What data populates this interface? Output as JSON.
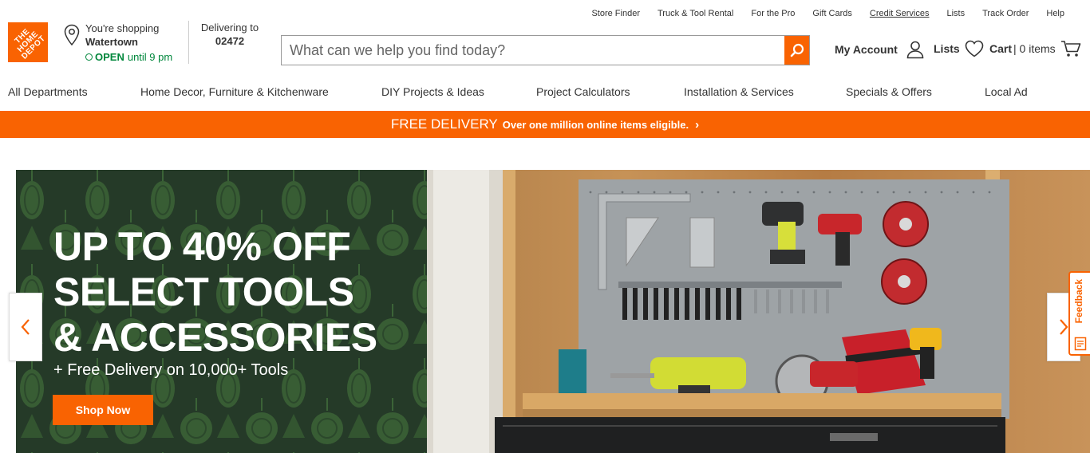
{
  "utility_links": [
    {
      "label": "Store Finder"
    },
    {
      "label": "Truck & Tool Rental"
    },
    {
      "label": "For the Pro"
    },
    {
      "label": "Gift Cards"
    },
    {
      "label": "Credit Services"
    },
    {
      "label": "Lists"
    },
    {
      "label": "Track Order"
    },
    {
      "label": "Help"
    }
  ],
  "logo": {
    "text": "THE\nHOME\nDEPOT",
    "icon": "home-depot-logo"
  },
  "store": {
    "shopping_label": "You're shopping",
    "name": "Watertown",
    "status": "OPEN",
    "hours": "until 9 pm"
  },
  "delivery": {
    "label": "Delivering to",
    "zip": "02472"
  },
  "search": {
    "placeholder": "What can we help you find today?",
    "value": ""
  },
  "account": {
    "my_account": "My Account",
    "lists": "Lists",
    "cart": "Cart",
    "cart_count": "0 items"
  },
  "nav": [
    {
      "label": "All Departments"
    },
    {
      "label": "Home Decor, Furniture & Kitchenware"
    },
    {
      "label": "DIY Projects & Ideas"
    },
    {
      "label": "Project Calculators"
    },
    {
      "label": "Installation & Services"
    },
    {
      "label": "Specials & Offers"
    },
    {
      "label": "Local Ad"
    }
  ],
  "promo": {
    "main": "FREE DELIVERY",
    "sub": "Over one million online items eligible."
  },
  "hero": {
    "headline": [
      "UP TO 40% OFF",
      "SELECT TOOLS",
      "& ACCESSORIES"
    ],
    "subline": "+ Free Delivery on 10,000+ Tools",
    "cta": "Shop Now"
  },
  "feedback": {
    "label": "Feedback"
  },
  "colors": {
    "brand_orange": "#f96302",
    "open_green": "#00873c",
    "hero_green": "#253a28"
  }
}
